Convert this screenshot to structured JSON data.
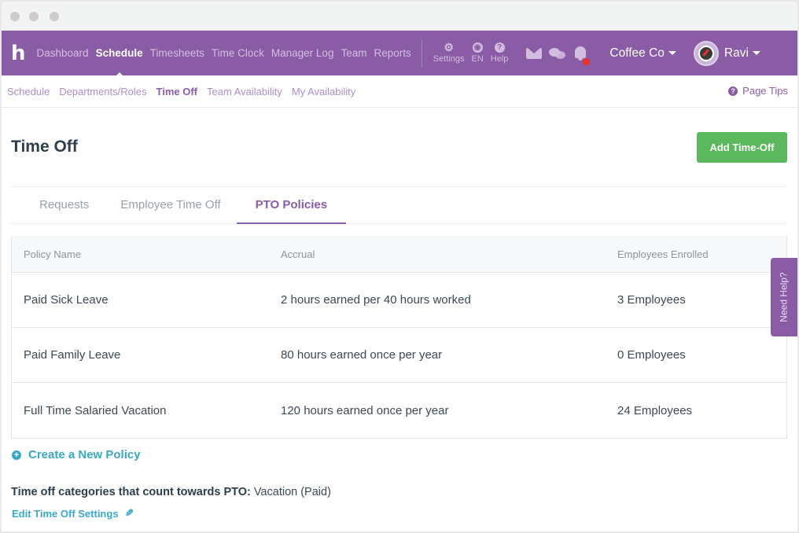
{
  "nav": {
    "logo": "h",
    "items": [
      {
        "label": "Dashboard",
        "active": false
      },
      {
        "label": "Schedule",
        "active": true
      },
      {
        "label": "Timesheets",
        "active": false
      },
      {
        "label": "Time Clock",
        "active": false
      },
      {
        "label": "Manager Log",
        "active": false
      },
      {
        "label": "Team",
        "active": false
      },
      {
        "label": "Reports",
        "active": false
      }
    ],
    "settings_label": "Settings",
    "language_label": "EN",
    "help_label": "Help",
    "company": "Coffee Co",
    "user": "Ravi",
    "notification_badge_color": "#e8322d"
  },
  "subnav": {
    "items": [
      {
        "label": "Schedule"
      },
      {
        "label": "Departments/Roles"
      },
      {
        "label": "Time Off"
      },
      {
        "label": "Team Availability"
      },
      {
        "label": "My Availability"
      }
    ],
    "page_tips": "Page Tips"
  },
  "page": {
    "title": "Time Off",
    "add_button": "Add Time-Off"
  },
  "tabs": [
    {
      "label": "Requests"
    },
    {
      "label": "Employee Time Off"
    },
    {
      "label": "PTO Policies"
    }
  ],
  "table": {
    "headers": [
      "Policy Name",
      "Accrual",
      "Employees Enrolled"
    ],
    "rows": [
      {
        "name": "Paid Sick Leave",
        "accrual": "2 hours earned per 40 hours worked",
        "enrolled": "3 Employees"
      },
      {
        "name": "Paid Family Leave",
        "accrual": "80 hours earned once per year",
        "enrolled": "0 Employees"
      },
      {
        "name": "Full Time Salaried Vacation",
        "accrual": "120 hours earned once per year",
        "enrolled": "24 Employees"
      }
    ]
  },
  "create_policy": "Create a New Policy",
  "categories": {
    "label": "Time off categories that count towards PTO:",
    "value": " Vacation (Paid)"
  },
  "edit_settings": "Edit Time Off Settings",
  "need_help": "Need Help?",
  "colors": {
    "brand_purple": "#8a5ca6",
    "success_green": "#5cb85c",
    "link_teal": "#3aa7c3"
  }
}
